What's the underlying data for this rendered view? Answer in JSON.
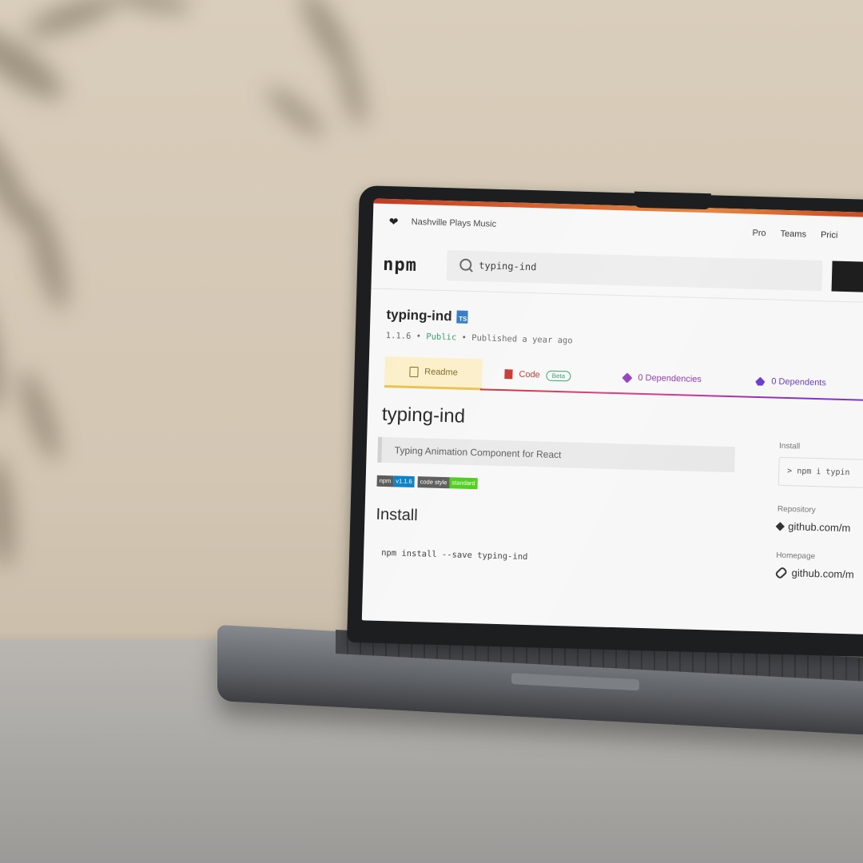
{
  "header": {
    "tagline": "Nashville Plays Music",
    "nav": [
      "Pro",
      "Teams",
      "Prici"
    ]
  },
  "search": {
    "logo": "npm",
    "value": "typing-ind"
  },
  "package": {
    "name": "typing-ind",
    "ts_badge": "TS",
    "version": "1.1.6",
    "visibility": "Public",
    "published": "Published a year ago",
    "separator": "•"
  },
  "tabs": {
    "readme": "Readme",
    "code": "Code",
    "code_badge": "Beta",
    "dependencies": "0 Dependencies",
    "dependents": "0 Dependents"
  },
  "readme": {
    "title": "typing-ind",
    "description": "Typing Animation Component for React",
    "shields": [
      {
        "label": "npm",
        "value": "v1.1.6"
      },
      {
        "label": "code style",
        "value": "standard"
      }
    ],
    "install_heading": "Install",
    "install_code": "npm install --save typing-ind"
  },
  "sidebar": {
    "install_label": "Install",
    "install_cmd": "> npm i typin",
    "repository_label": "Repository",
    "repository_value": "github.com/m",
    "homepage_label": "Homepage",
    "homepage_value": "github.com/m"
  },
  "colors": {
    "npm_red": "#c4302b",
    "public_green": "#2a9d68",
    "typescript_blue": "#3178c6",
    "dependencies_purple": "#8b33b8"
  }
}
